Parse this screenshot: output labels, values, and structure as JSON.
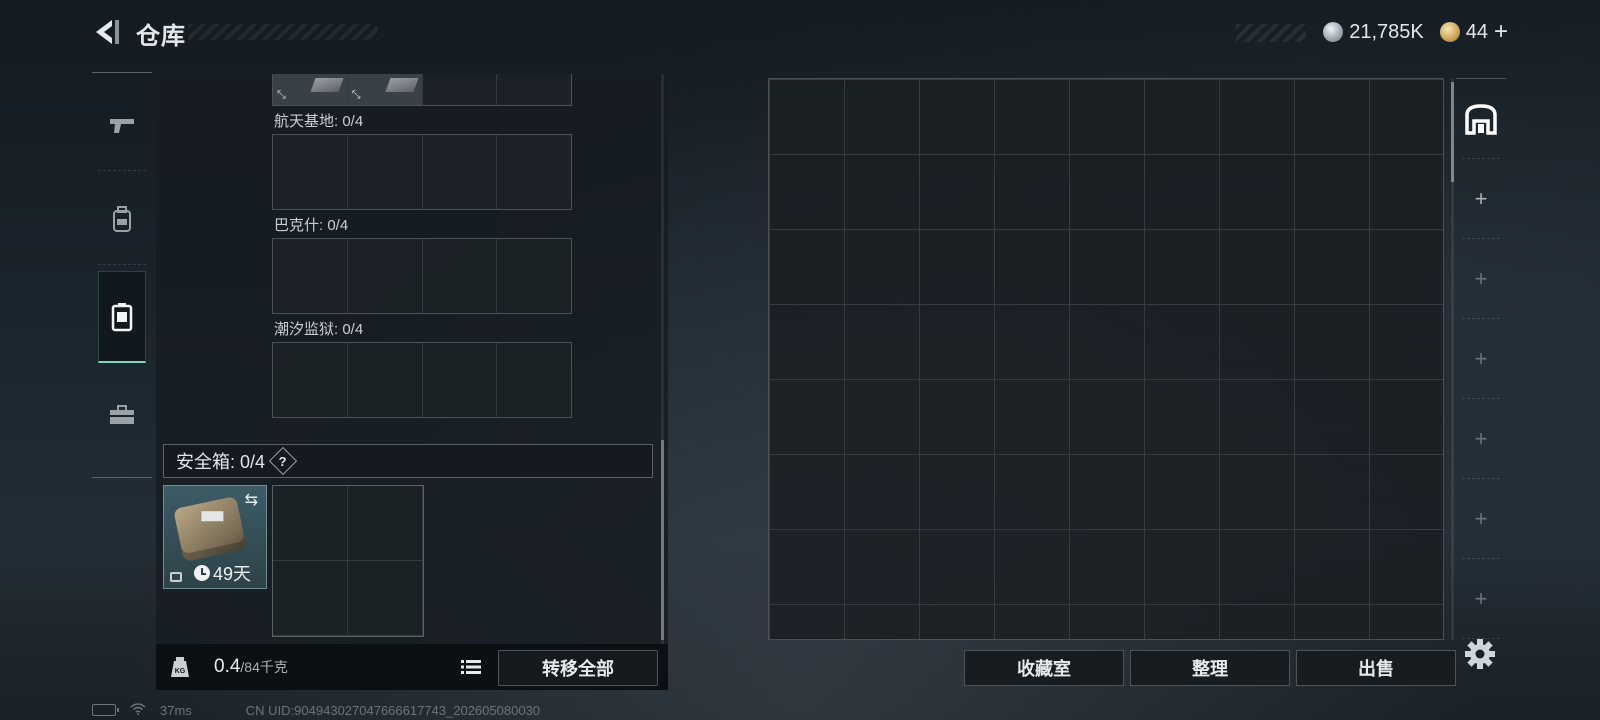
{
  "header": {
    "title": "仓库",
    "currency_primary": "21,785K",
    "currency_secondary": "44",
    "add_label": "+"
  },
  "left_tabs": [
    {
      "name": "weapons",
      "icon": "pistol-icon"
    },
    {
      "name": "equipment",
      "icon": "backpack-icon"
    },
    {
      "name": "storage",
      "icon": "locker-icon",
      "active": true
    },
    {
      "name": "toolbox",
      "icon": "toolbox-icon"
    }
  ],
  "storage": {
    "top_items": [
      {
        "tag": "⤡"
      },
      {
        "tag": "⤡"
      }
    ],
    "sections": [
      {
        "label": "航天基地: 0/4"
      },
      {
        "label": "巴克什: 0/4"
      },
      {
        "label": "潮汐监狱: 0/4"
      }
    ]
  },
  "safe_box": {
    "label": "安全箱: 0/4",
    "help": "?",
    "swap_icon": "⇆",
    "time_left": "49天"
  },
  "weight": {
    "current": "0.4",
    "max": "/84千克"
  },
  "buttons": {
    "transfer_all": "转移全部",
    "collection": "收藏室",
    "organize": "整理",
    "sell": "出售"
  },
  "side_slots": [
    "⌂",
    "+",
    "+",
    "+",
    "+",
    "+",
    "+"
  ],
  "status": {
    "ping": "37ms",
    "uid": "CN UID:904943027047666617743_202605080030"
  },
  "colors": {
    "accent": "#7fd6b6",
    "panel": "#1a1f23",
    "border": "#4a5157"
  }
}
